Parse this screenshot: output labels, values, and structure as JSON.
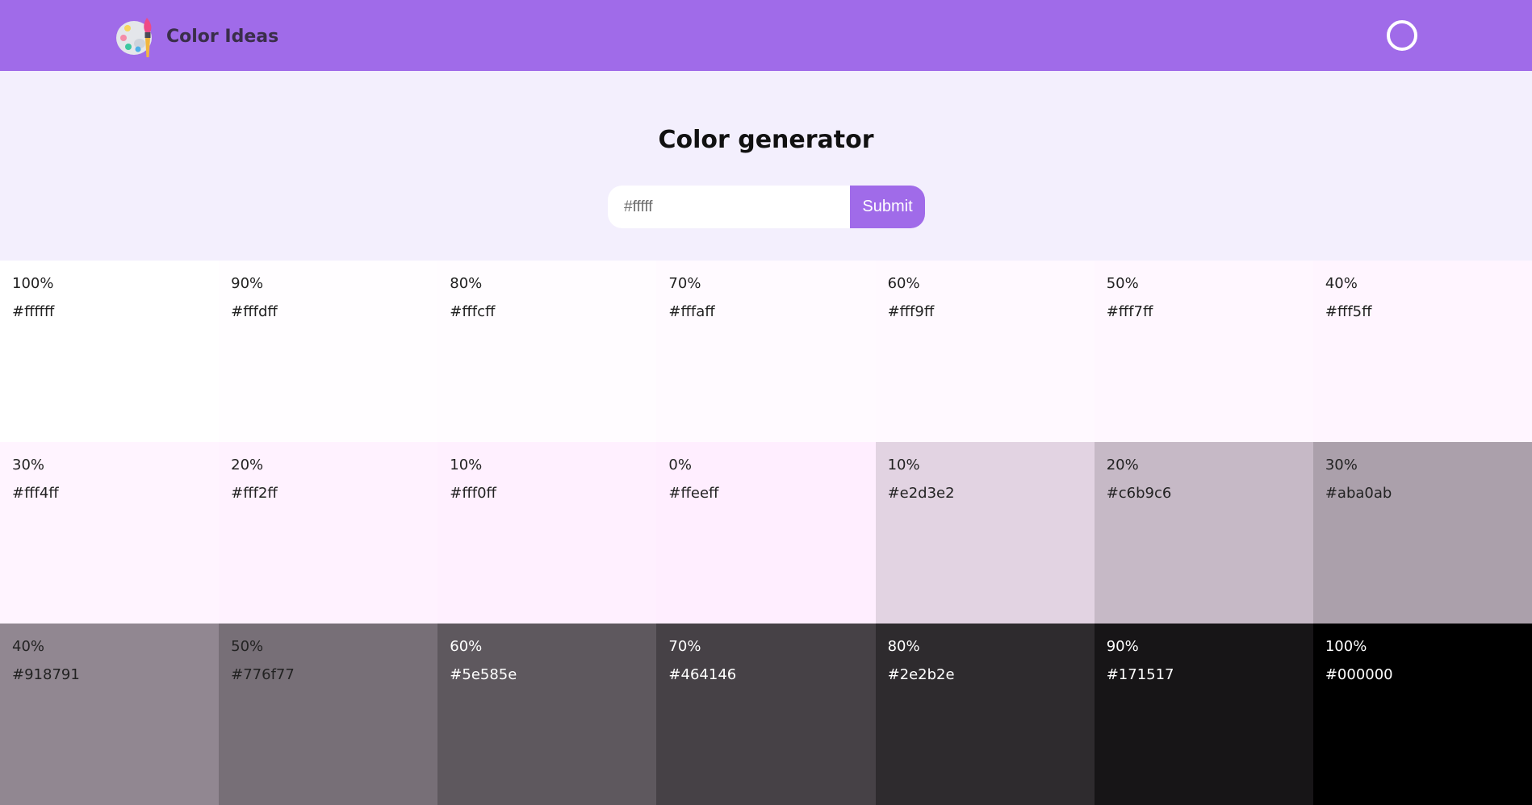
{
  "header": {
    "title": "Color Ideas",
    "logo_icon": "palette-brush-icon",
    "theme_toggle_icon": "circle-icon"
  },
  "hero": {
    "heading": "Color generator",
    "input_placeholder": "#fffff",
    "submit_label": "Submit"
  },
  "colors": {
    "header_bg": "#a06be9",
    "hero_bg": "#f3effd",
    "button_bg": "#a06be9"
  },
  "swatches": [
    {
      "percent": "100%",
      "hex": "#ffffff",
      "text": "#222222"
    },
    {
      "percent": "90%",
      "hex": "#fffdff",
      "text": "#222222"
    },
    {
      "percent": "80%",
      "hex": "#fffcff",
      "text": "#222222"
    },
    {
      "percent": "70%",
      "hex": "#fffaff",
      "text": "#222222"
    },
    {
      "percent": "60%",
      "hex": "#fff9ff",
      "text": "#222222"
    },
    {
      "percent": "50%",
      "hex": "#fff7ff",
      "text": "#222222"
    },
    {
      "percent": "40%",
      "hex": "#fff5ff",
      "text": "#222222"
    },
    {
      "percent": "30%",
      "hex": "#fff4ff",
      "text": "#222222"
    },
    {
      "percent": "20%",
      "hex": "#fff2ff",
      "text": "#222222"
    },
    {
      "percent": "10%",
      "hex": "#fff0ff",
      "text": "#222222"
    },
    {
      "percent": "0%",
      "hex": "#ffeeff",
      "text": "#222222"
    },
    {
      "percent": "10%",
      "hex": "#e2d3e2",
      "text": "#222222"
    },
    {
      "percent": "20%",
      "hex": "#c6b9c6",
      "text": "#222222"
    },
    {
      "percent": "30%",
      "hex": "#aba0ab",
      "text": "#222222"
    },
    {
      "percent": "40%",
      "hex": "#918791",
      "text": "#222222"
    },
    {
      "percent": "50%",
      "hex": "#776f77",
      "text": "#222222"
    },
    {
      "percent": "60%",
      "hex": "#5e585e",
      "text": "#ffffff"
    },
    {
      "percent": "70%",
      "hex": "#464146",
      "text": "#ffffff"
    },
    {
      "percent": "80%",
      "hex": "#2e2b2e",
      "text": "#ffffff"
    },
    {
      "percent": "90%",
      "hex": "#171517",
      "text": "#ffffff"
    },
    {
      "percent": "100%",
      "hex": "#000000",
      "text": "#ffffff"
    }
  ]
}
